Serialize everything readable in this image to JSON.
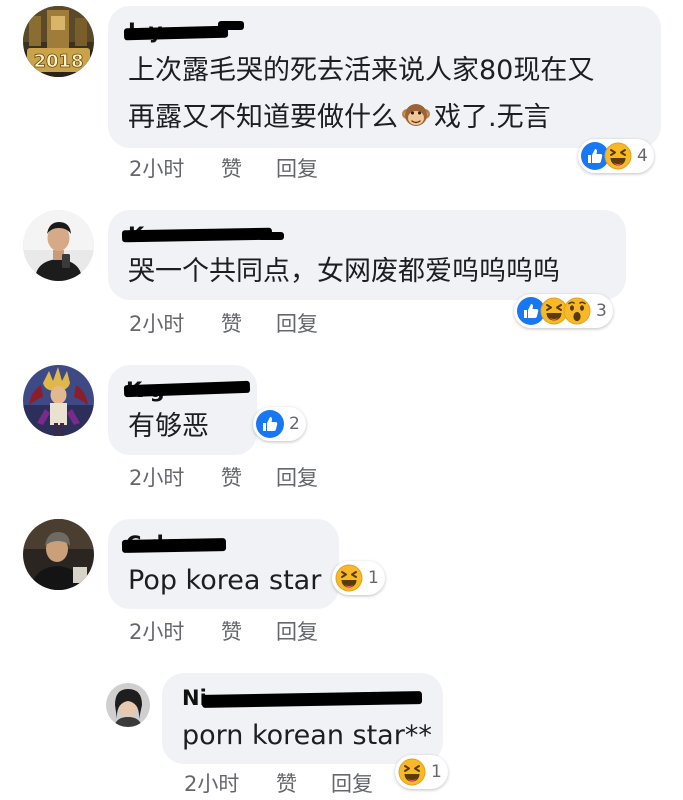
{
  "colors": {
    "bubble": "#f0f2f5",
    "like": "#1877f2",
    "emoji_yellow": "#f7b928",
    "meta_text": "#65676b"
  },
  "comments": [
    {
      "name": "L        y",
      "text_lines": [
        "上次露毛哭的死去活来说人家80现在又",
        "再露又不知道要做什么",
        "戏了.无言"
      ],
      "inline_emoji": "monkey-emoji",
      "time": "2小时",
      "like_label": "赞",
      "reply_label": "回复",
      "reactions": [
        "like",
        "haha"
      ],
      "reaction_count": "4",
      "avatar_badge": "2018"
    },
    {
      "name": "K",
      "text_lines": [
        "哭一个共同点，女网废都爱呜呜呜呜"
      ],
      "time": "2小时",
      "like_label": "赞",
      "reply_label": "回复",
      "reactions": [
        "like",
        "haha",
        "wow"
      ],
      "reaction_count": "3"
    },
    {
      "name": "K          g",
      "text_lines": [
        "有够恶"
      ],
      "time": "2小时",
      "like_label": "赞",
      "reply_label": "回复",
      "reactions": [
        "like"
      ],
      "reaction_count": "2"
    },
    {
      "name": "C       do",
      "text_lines": [
        "Pop korea star"
      ],
      "time": "2小时",
      "like_label": "赞",
      "reply_label": "回复",
      "reactions": [
        "haha"
      ],
      "reaction_count": "1"
    },
    {
      "name": "Ni",
      "text_lines": [
        "porn korean star**"
      ],
      "time": "2小时",
      "like_label": "赞",
      "reply_label": "回复",
      "reactions": [
        "haha"
      ],
      "reaction_count": "1"
    }
  ]
}
